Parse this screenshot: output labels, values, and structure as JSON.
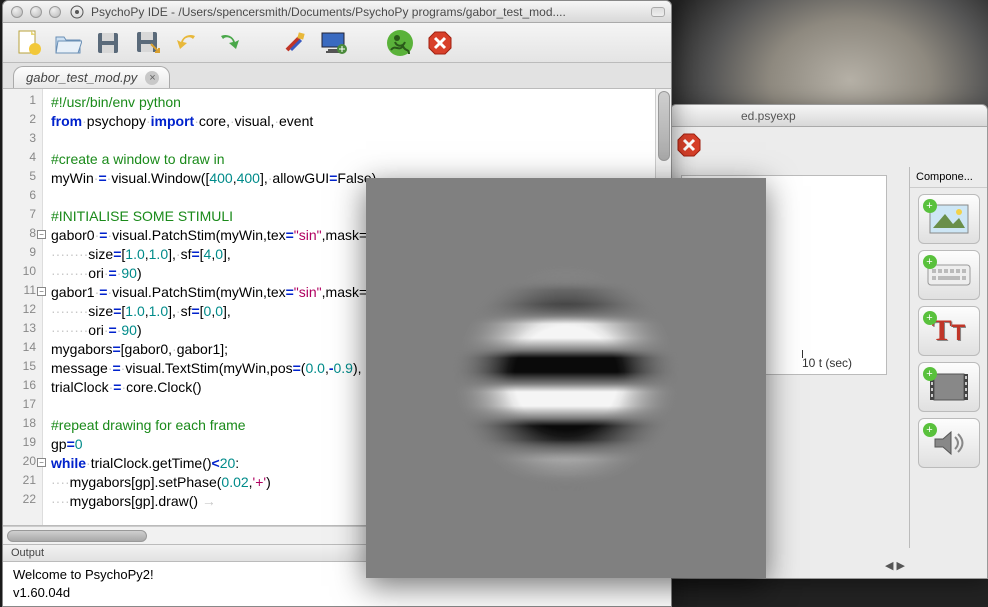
{
  "ide": {
    "title": "PsychoPy IDE - /Users/spencersmith/Documents/PsychoPy programs/gabor_test_mod....",
    "tab_label": "gabor_test_mod.py",
    "toolbar": {
      "new": "new-file-icon",
      "open": "open-file-icon",
      "save": "save-icon",
      "saveas": "save-as-icon",
      "undo": "undo-icon",
      "redo": "redo-icon",
      "settings": "settings-icon",
      "monitor": "monitor-icon",
      "run": "run-icon",
      "stop": "stop-icon"
    },
    "output_header": "Output",
    "output_lines": [
      "Welcome to PsychoPy2!",
      "v1.60.04d"
    ],
    "line_count": 22,
    "fold_lines": [
      8,
      11,
      20
    ],
    "code_lines": [
      {
        "t": "com",
        "txt": "#!/usr/bin/env python"
      },
      {
        "t": "mix",
        "seg": [
          {
            "c": "kw",
            "v": "from"
          },
          {
            "c": "ws",
            "v": "·"
          },
          {
            "c": "",
            "v": "psychopy"
          },
          {
            "c": "ws",
            "v": "·"
          },
          {
            "c": "kw",
            "v": "import"
          },
          {
            "c": "ws",
            "v": "·"
          },
          {
            "c": "",
            "v": "core,"
          },
          {
            "c": "ws",
            "v": "·"
          },
          {
            "c": "",
            "v": "visual,"
          },
          {
            "c": "ws",
            "v": "·"
          },
          {
            "c": "",
            "v": "event"
          }
        ]
      },
      {
        "t": "",
        "txt": ""
      },
      {
        "t": "com",
        "txt": "#create a window to draw in"
      },
      {
        "t": "mix",
        "seg": [
          {
            "c": "",
            "v": "myWin"
          },
          {
            "c": "ws",
            "v": "·"
          },
          {
            "c": "op",
            "v": "="
          },
          {
            "c": "ws",
            "v": "·"
          },
          {
            "c": "",
            "v": "visual.Window(["
          },
          {
            "c": "num",
            "v": "400"
          },
          {
            "c": "",
            "v": ","
          },
          {
            "c": "num",
            "v": "400"
          },
          {
            "c": "",
            "v": "],"
          },
          {
            "c": "ws",
            "v": "·"
          },
          {
            "c": "",
            "v": "allowGUI"
          },
          {
            "c": "op",
            "v": "="
          },
          {
            "c": "",
            "v": "False)"
          }
        ]
      },
      {
        "t": "",
        "txt": ""
      },
      {
        "t": "com",
        "txt": "#INITIALISE SOME STIMULI"
      },
      {
        "t": "mix",
        "seg": [
          {
            "c": "",
            "v": "gabor0"
          },
          {
            "c": "ws",
            "v": "·"
          },
          {
            "c": "op",
            "v": "="
          },
          {
            "c": "ws",
            "v": "·"
          },
          {
            "c": "",
            "v": "visual.PatchStim(myWin,tex"
          },
          {
            "c": "op",
            "v": "="
          },
          {
            "c": "str",
            "v": "\"sin\""
          },
          {
            "c": "",
            "v": ",mask="
          }
        ]
      },
      {
        "t": "mix",
        "seg": [
          {
            "c": "ws",
            "v": "········"
          },
          {
            "c": "",
            "v": "size"
          },
          {
            "c": "op",
            "v": "="
          },
          {
            "c": "",
            "v": "["
          },
          {
            "c": "num",
            "v": "1.0"
          },
          {
            "c": "",
            "v": ","
          },
          {
            "c": "num",
            "v": "1.0"
          },
          {
            "c": "",
            "v": "],"
          },
          {
            "c": "ws",
            "v": "·"
          },
          {
            "c": "",
            "v": "sf"
          },
          {
            "c": "op",
            "v": "="
          },
          {
            "c": "",
            "v": "["
          },
          {
            "c": "num",
            "v": "4"
          },
          {
            "c": "",
            "v": ","
          },
          {
            "c": "num",
            "v": "0"
          },
          {
            "c": "",
            "v": "],"
          }
        ]
      },
      {
        "t": "mix",
        "seg": [
          {
            "c": "ws",
            "v": "········"
          },
          {
            "c": "",
            "v": "ori"
          },
          {
            "c": "ws",
            "v": "·"
          },
          {
            "c": "op",
            "v": "="
          },
          {
            "c": "ws",
            "v": "·"
          },
          {
            "c": "num",
            "v": "90"
          },
          {
            "c": "",
            "v": ")"
          }
        ]
      },
      {
        "t": "mix",
        "seg": [
          {
            "c": "",
            "v": "gabor1"
          },
          {
            "c": "ws",
            "v": "·"
          },
          {
            "c": "op",
            "v": "="
          },
          {
            "c": "ws",
            "v": "·"
          },
          {
            "c": "",
            "v": "visual.PatchStim(myWin,tex"
          },
          {
            "c": "op",
            "v": "="
          },
          {
            "c": "str",
            "v": "\"sin\""
          },
          {
            "c": "",
            "v": ",mask="
          }
        ]
      },
      {
        "t": "mix",
        "seg": [
          {
            "c": "ws",
            "v": "········"
          },
          {
            "c": "",
            "v": "size"
          },
          {
            "c": "op",
            "v": "="
          },
          {
            "c": "",
            "v": "["
          },
          {
            "c": "num",
            "v": "1.0"
          },
          {
            "c": "",
            "v": ","
          },
          {
            "c": "num",
            "v": "1.0"
          },
          {
            "c": "",
            "v": "],"
          },
          {
            "c": "ws",
            "v": "·"
          },
          {
            "c": "",
            "v": "sf"
          },
          {
            "c": "op",
            "v": "="
          },
          {
            "c": "",
            "v": "["
          },
          {
            "c": "num",
            "v": "0"
          },
          {
            "c": "",
            "v": ","
          },
          {
            "c": "num",
            "v": "0"
          },
          {
            "c": "",
            "v": "],"
          }
        ]
      },
      {
        "t": "mix",
        "seg": [
          {
            "c": "ws",
            "v": "········"
          },
          {
            "c": "",
            "v": "ori"
          },
          {
            "c": "ws",
            "v": "·"
          },
          {
            "c": "op",
            "v": "="
          },
          {
            "c": "ws",
            "v": "·"
          },
          {
            "c": "num",
            "v": "90"
          },
          {
            "c": "",
            "v": ")"
          }
        ]
      },
      {
        "t": "mix",
        "seg": [
          {
            "c": "",
            "v": "mygabors"
          },
          {
            "c": "op",
            "v": "="
          },
          {
            "c": "",
            "v": "[gabor0,"
          },
          {
            "c": "ws",
            "v": "·"
          },
          {
            "c": "",
            "v": "gabor1];"
          }
        ]
      },
      {
        "t": "mix",
        "seg": [
          {
            "c": "",
            "v": "message"
          },
          {
            "c": "ws",
            "v": "·"
          },
          {
            "c": "op",
            "v": "="
          },
          {
            "c": "ws",
            "v": "·"
          },
          {
            "c": "",
            "v": "visual.TextStim(myWin,pos"
          },
          {
            "c": "op",
            "v": "="
          },
          {
            "c": "",
            "v": "("
          },
          {
            "c": "num",
            "v": "0.0"
          },
          {
            "c": "",
            "v": ","
          },
          {
            "c": "op",
            "v": "-"
          },
          {
            "c": "num",
            "v": "0.9"
          },
          {
            "c": "",
            "v": "),"
          }
        ]
      },
      {
        "t": "mix",
        "seg": [
          {
            "c": "",
            "v": "trialClock"
          },
          {
            "c": "ws",
            "v": "·"
          },
          {
            "c": "op",
            "v": "="
          },
          {
            "c": "ws",
            "v": "·"
          },
          {
            "c": "",
            "v": "core.Clock()"
          }
        ]
      },
      {
        "t": "",
        "txt": ""
      },
      {
        "t": "com",
        "txt": "#repeat drawing for each frame"
      },
      {
        "t": "mix",
        "seg": [
          {
            "c": "",
            "v": "gp"
          },
          {
            "c": "op",
            "v": "="
          },
          {
            "c": "num",
            "v": "0"
          }
        ]
      },
      {
        "t": "mix",
        "seg": [
          {
            "c": "kw",
            "v": "while"
          },
          {
            "c": "ws",
            "v": "·"
          },
          {
            "c": "",
            "v": "trialClock.getTime()"
          },
          {
            "c": "op",
            "v": "<"
          },
          {
            "c": "num",
            "v": "20"
          },
          {
            "c": "",
            "v": ":"
          }
        ]
      },
      {
        "t": "mix",
        "seg": [
          {
            "c": "ws",
            "v": "····"
          },
          {
            "c": "",
            "v": "mygabors[gp].setPhase("
          },
          {
            "c": "num",
            "v": "0.02"
          },
          {
            "c": "",
            "v": ","
          },
          {
            "c": "str",
            "v": "'+'"
          },
          {
            "c": "",
            "v": ")"
          }
        ]
      },
      {
        "t": "mix",
        "seg": [
          {
            "c": "ws",
            "v": "····"
          },
          {
            "c": "",
            "v": "mygabors[gp].draw()"
          },
          {
            "c": "ws",
            "v": " →"
          }
        ]
      }
    ]
  },
  "back": {
    "title_suffix": "ed.psyexp",
    "components_header": "Compone...",
    "tlabel_num": "10",
    "tlabel_unit": "t (sec)",
    "items": [
      "image",
      "keyboard",
      "text",
      "movie",
      "sound"
    ]
  }
}
